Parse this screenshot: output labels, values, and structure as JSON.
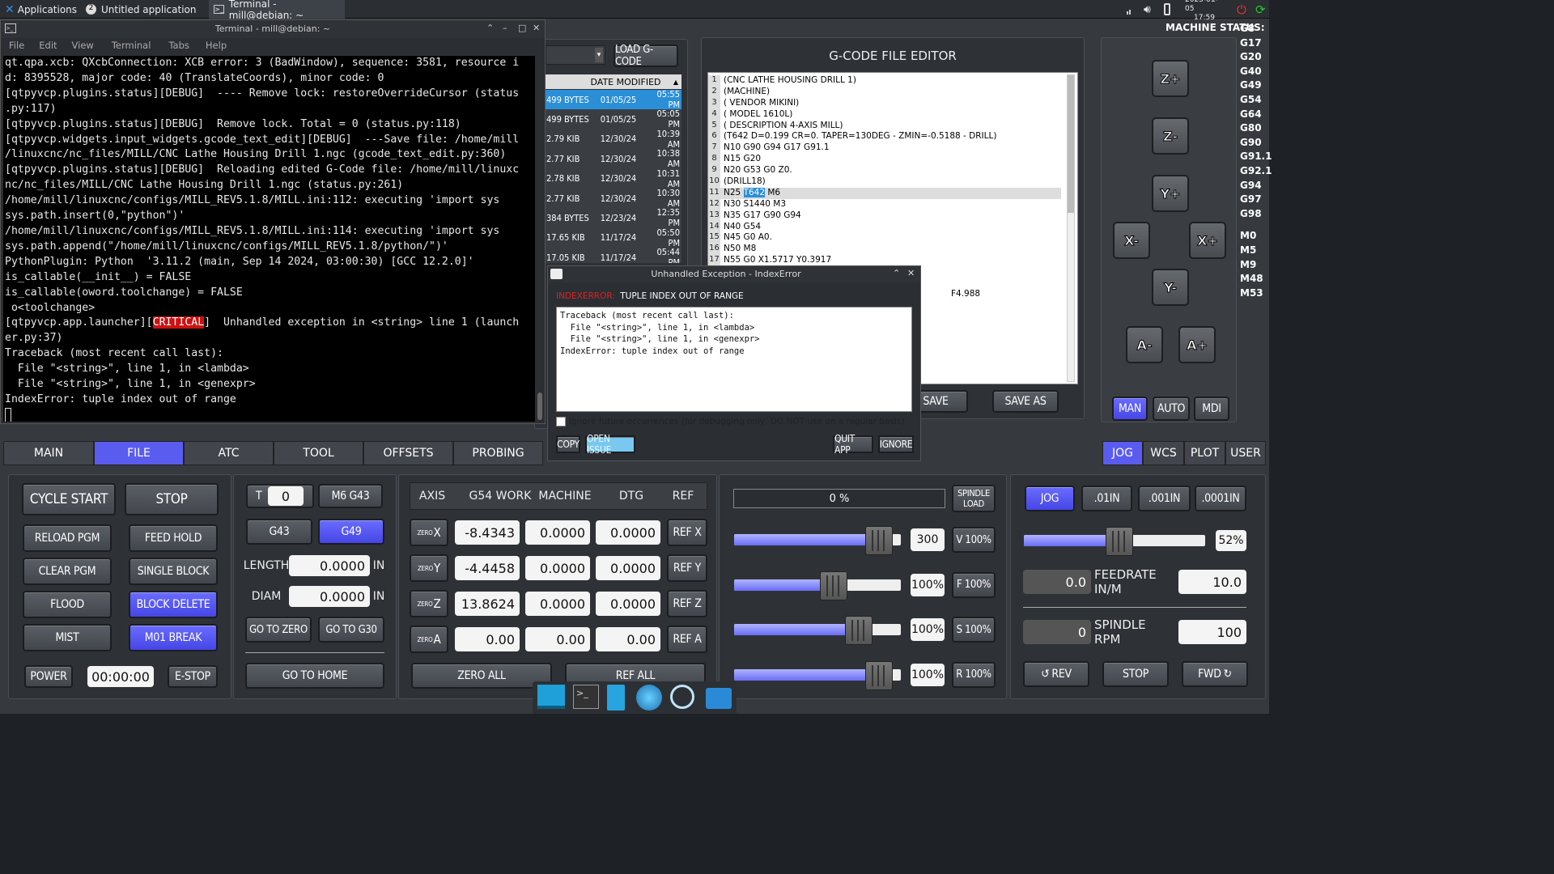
{
  "topbar": {
    "applications": "Applications",
    "untitled": "Untitled application",
    "untitled_badge": "2",
    "terminal_task": "Terminal - mill@debian: ~",
    "date": "2025-01-05",
    "time": "17:59"
  },
  "machine_status_label": "MACHINE STATUS:",
  "gcodes": [
    "G8",
    "G17",
    "G20",
    "G40",
    "G49",
    "G54",
    "G64",
    "G80",
    "G90",
    "G91.1",
    "G92.1",
    "G94",
    "G97",
    "G98",
    "M0",
    "M5",
    "M9",
    "M48",
    "M53"
  ],
  "terminal": {
    "title": "Terminal - mill@debian: ~",
    "menu": [
      "File",
      "Edit",
      "View",
      "Terminal",
      "Tabs",
      "Help"
    ],
    "lines": [
      "qt.qpa.xcb: QXcbConnection: XCB error: 3 (BadWindow), sequence: 3581, resource i",
      "d: 8395528, major code: 40 (TranslateCoords), minor code: 0",
      "[qtpyvcp.plugins.status][DEBUG]  ---- Remove lock: restoreOverrideCursor (status",
      ".py:117)",
      "[qtpyvcp.plugins.status][DEBUG]  Remove lock. Total = 0 (status.py:118)",
      "[qtpyvcp.widgets.input_widgets.gcode_text_edit][DEBUG]  ---Save file: /home/mill",
      "/linuxcnc/nc_files/MILL/CNC Lathe Housing Drill 1.ngc (gcode_text_edit.py:360)",
      "[qtpyvcp.plugins.status][DEBUG]  Reloading edited G-Code file: /home/mill/linuxc",
      "nc/nc_files/MILL/CNC Lathe Housing Drill 1.ngc (status.py:261)",
      "/home/mill/linuxcnc/configs/MILL_REV5.1.8/MILL.ini:112: executing 'import sys",
      "sys.path.insert(0,\"python\")'",
      "/home/mill/linuxcnc/configs/MILL_REV5.1.8/MILL.ini:114: executing 'import sys",
      "sys.path.append(\"/home/mill/linuxcnc/configs/MILL_REV5.1.8/python/\")'",
      "PythonPlugin: Python  '3.11.2 (main, Sep 14 2024, 03:00:30) [GCC 12.2.0]'",
      "is_callable(__init__) = FALSE",
      "is_callable(oword.toolchange) = FALSE",
      " o<toolchange>"
    ],
    "crit_prefix": "[qtpyvcp.app.launcher][",
    "crit_word": "CRITICAL",
    "crit_suffix": "]  Unhandled exception in <string> line 1 (launch",
    "lines2": [
      "er.py:37)",
      "Traceback (most recent call last):",
      "  File \"<string>\", line 1, in <lambda>",
      "  File \"<string>\", line 1, in <genexpr>",
      "IndexError: tuple index out of range"
    ]
  },
  "files": {
    "load_label": "LOAD G-CODE",
    "header": "DATE MODIFIED",
    "rows": [
      {
        "size": "499 BYTES",
        "date": "01/05/25",
        "time": "05:55 PM"
      },
      {
        "size": "499 BYTES",
        "date": "01/05/25",
        "time": "05:05 PM"
      },
      {
        "size": "2.79 KIB",
        "date": "12/30/24",
        "time": "10:39 AM"
      },
      {
        "size": "2.77 KIB",
        "date": "12/30/24",
        "time": "10:38 AM"
      },
      {
        "size": "2.78 KIB",
        "date": "12/30/24",
        "time": "10:31 AM"
      },
      {
        "size": "2.77 KIB",
        "date": "12/30/24",
        "time": "10:30 AM"
      },
      {
        "size": "384 BYTES",
        "date": "12/23/24",
        "time": "12:35 PM"
      },
      {
        "size": "17.65 KIB",
        "date": "11/17/24",
        "time": "05:50 PM"
      },
      {
        "size": "17.05 KIB",
        "date": "11/17/24",
        "time": "05:44 PM"
      }
    ]
  },
  "editor": {
    "title": "G-CODE FILE EDITOR",
    "save": "SAVE",
    "save_as": "SAVE AS",
    "extra": "F4.988",
    "lines": [
      "(CNC LATHE HOUSING DRILL 1)",
      "(MACHINE)",
      "(  VENDOR MIKINI)",
      "(  MODEL 1610L)",
      "(  DESCRIPTION 4-AXIS MILL)",
      "(T642 D=0.199 CR=0. TAPER=130DEG - ZMIN=-0.5188 - DRILL)",
      "N10 G90 G94 G17 G91.1",
      "N15 G20",
      "N20 G53 G0 Z0.",
      "(DRILL18)",
      "N25 T642 M6",
      "N30 S1440 M3",
      "N35 G17 G90 G94",
      "N40 G54",
      "N45 G0 A0.",
      "N50 M8",
      "N55 G0 X1.5717 Y0.3917"
    ]
  },
  "dialog": {
    "title": "Unhandled Exception - IndexError",
    "err_type": "INDEXERROR:",
    "err_msg": "TUPLE INDEX OUT OF RANGE",
    "trace": [
      "Traceback (most recent call last):",
      "  File \"<string>\", line 1, in <lambda>",
      "  File \"<string>\", line 1, in <genexpr>",
      "IndexError: tuple index out of range"
    ],
    "ignore_text": "Ignore future occurrences (for debugging only, DO NOT use on a regular basis)",
    "copy": "COPY",
    "open_issue": "OPEN ISSUE",
    "quit": "QUIT APP",
    "ignore": "IGNORE"
  },
  "jog_axes": {
    "zp": "Z+",
    "zm": "Z-",
    "yp": "Y+",
    "xm": "X-",
    "xp": "X+",
    "ym": "Y-",
    "am": "A-",
    "ap": "A+"
  },
  "modes": [
    "MAN",
    "AUTO",
    "MDI"
  ],
  "tabs": [
    "MAIN",
    "FILE",
    "ATC",
    "TOOL",
    "OFFSETS",
    "PROBING"
  ],
  "right_tabs": [
    "JOG",
    "WCS",
    "PLOT",
    "USER"
  ],
  "left": {
    "cycle_start": "CYCLE START",
    "stop": "STOP",
    "reload": "RELOAD PGM",
    "feed_hold": "FEED HOLD",
    "clear": "CLEAR PGM",
    "single": "SINGLE BLOCK",
    "flood": "FLOOD",
    "block_delete": "BLOCK DELETE",
    "mist": "MIST",
    "m01": "M01 BREAK",
    "power": "POWER",
    "timer": "00:00:00",
    "estop": "E-STOP"
  },
  "tool": {
    "t": "T",
    "t_val": "0",
    "m6": "M6 G43",
    "g43": "G43",
    "g49": "G49",
    "length": "LENGTH",
    "length_val": "0.0000",
    "in": "IN",
    "diam": "DIAM",
    "diam_val": "0.0000",
    "go_zero": "GO TO ZERO",
    "go_g30": "GO TO G30",
    "go_home": "GO TO HOME"
  },
  "dro": {
    "headers": [
      "AXIS",
      "G54 WORK",
      "MACHINE",
      "DTG",
      "REF"
    ],
    "zero": "ZERO",
    "rows": [
      {
        "axis": "X",
        "work": "-8.4343",
        "mach": "0.0000",
        "dtg": "0.0000",
        "ref": "REF X"
      },
      {
        "axis": "Y",
        "work": "-4.4458",
        "mach": "0.0000",
        "dtg": "0.0000",
        "ref": "REF Y"
      },
      {
        "axis": "Z",
        "work": "13.8624",
        "mach": "0.0000",
        "dtg": "0.0000",
        "ref": "REF Z"
      },
      {
        "axis": "A",
        "work": "0.00",
        "mach": "0.00",
        "dtg": "0.00",
        "ref": "REF A"
      }
    ],
    "zero_all": "ZERO ALL",
    "ref_all": "REF ALL"
  },
  "spindle": {
    "load_pct": "0 %",
    "load_label": "SPINDLE LOAD",
    "sliders": [
      {
        "val": "300",
        "btn": "V 100%",
        "level": 0.86
      },
      {
        "val": "100%",
        "btn": "F 100%",
        "level": 0.59
      },
      {
        "val": "100%",
        "btn": "S 100%",
        "level": 0.74
      },
      {
        "val": "100%",
        "btn": "R 100%",
        "level": 0.86
      }
    ]
  },
  "jogpanel": {
    "jog": "JOG",
    "inc": [
      ".01IN",
      ".001IN",
      ".0001IN"
    ],
    "pct": "52%",
    "level": 0.52,
    "feed_val": "0.0",
    "feed_label": "FEEDRATE IN/M",
    "feed_set": "10.0",
    "rpm_val": "0",
    "rpm_label": "SPINDLE RPM",
    "rpm_set": "100",
    "rev": "REV",
    "stop": "STOP",
    "fwd": "FWD"
  }
}
